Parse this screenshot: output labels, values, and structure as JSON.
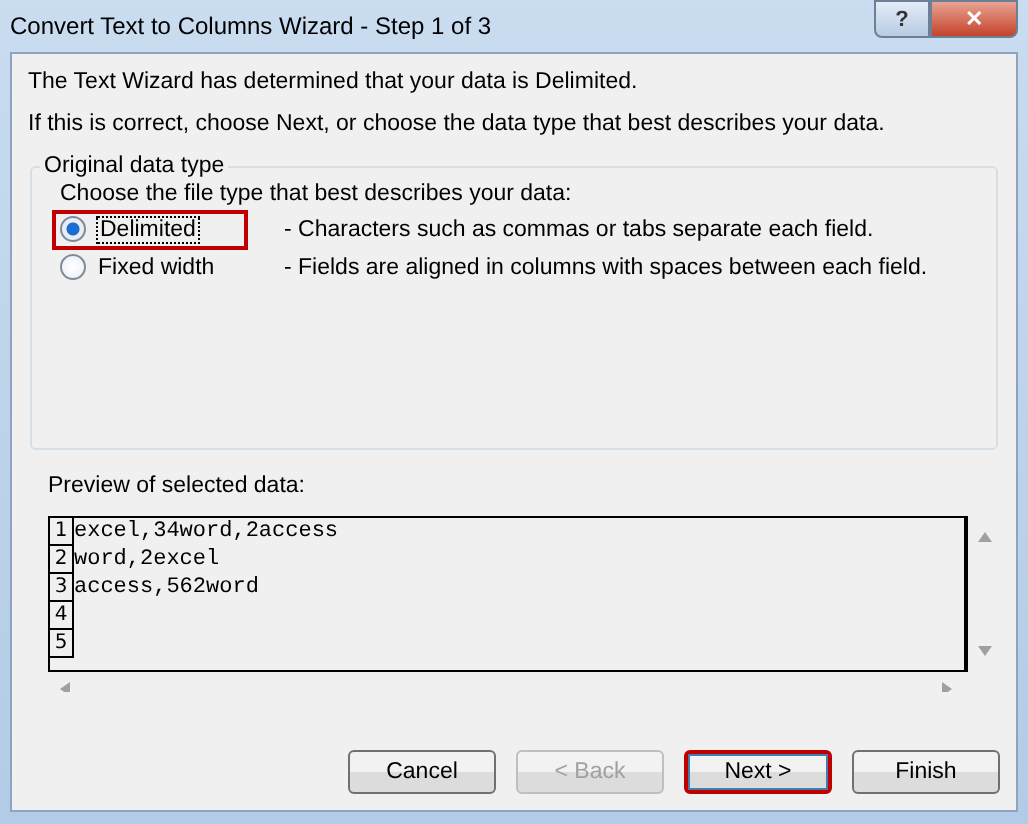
{
  "window": {
    "title": "Convert Text to Columns Wizard - Step 1 of 3",
    "controls": [
      "?",
      "✕"
    ]
  },
  "intro": [
    "The Text Wizard has determined that your data is Delimited.",
    "If this is correct, choose Next, or choose the data type that best describes your data."
  ],
  "group": {
    "legend": "Original data type",
    "prompt": "Choose the file type that best describes your data:",
    "options": [
      {
        "label": "Delimited",
        "description": "- Characters such as commas or tabs separate each field.",
        "selected": true,
        "highlighted": true
      },
      {
        "label": "Fixed width",
        "description": "- Fields are aligned in columns with spaces between each field.",
        "selected": false,
        "highlighted": false
      }
    ]
  },
  "preview": {
    "label": "Preview of selected data:",
    "rows": [
      {
        "number": "1",
        "text": "excel,34word,2access"
      },
      {
        "number": "2",
        "text": "word,2excel"
      },
      {
        "number": "3",
        "text": "access,562word"
      },
      {
        "number": "4",
        "text": ""
      },
      {
        "number": "5",
        "text": ""
      }
    ]
  },
  "buttons": [
    {
      "label": "Cancel",
      "disabled": false,
      "highlighted": false
    },
    {
      "label": "< Back",
      "disabled": true,
      "highlighted": false
    },
    {
      "label": "Next >",
      "disabled": false,
      "highlighted": true
    },
    {
      "label": "Finish",
      "disabled": false,
      "highlighted": false
    }
  ]
}
